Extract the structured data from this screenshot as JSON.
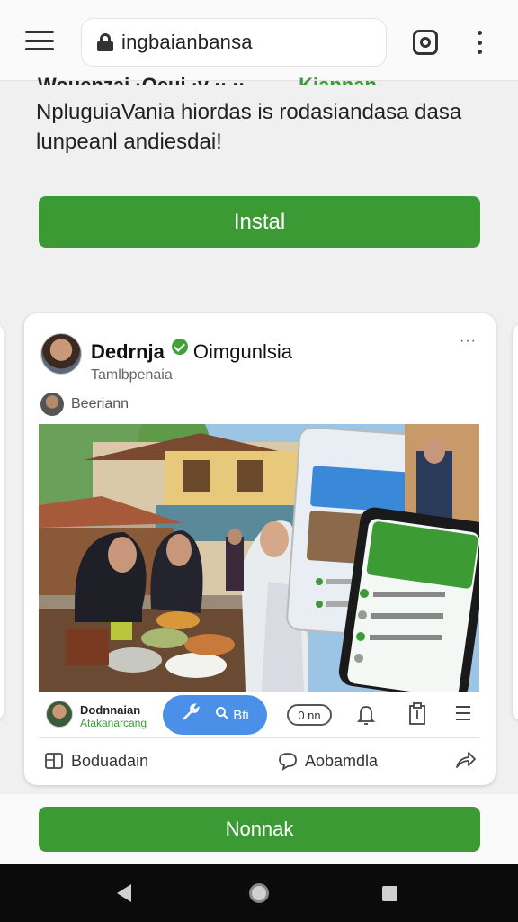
{
  "browser": {
    "url": "ingbaianbansa"
  },
  "intro": {
    "cut_heading": "Wouenzai ·Oeui ‧y ‧‧ ‧‧",
    "cut_heading_accent": "Kiapnan",
    "description": "NpluguiaVania hiordas is rodasiandasa dasa lunpeanl andiesdai!"
  },
  "install_button": "Instal",
  "post": {
    "page_name": "Dedrnja",
    "page_name_secondary": "Oimgunlsia",
    "page_sub": "Tamlbpenaia",
    "more": "···",
    "user_name": "Beeriann",
    "bar": {
      "name": "Dodnnaian",
      "sub": "Atakanarcang",
      "pill_label": "Bti",
      "chip_label": "0 nn"
    },
    "actions": {
      "left_label": "Boduadain",
      "right_label": "Aobamdla"
    }
  },
  "download_button": "Nonnak",
  "colors": {
    "accent_green": "#3b9a34",
    "pill_blue": "#4a90e8"
  }
}
